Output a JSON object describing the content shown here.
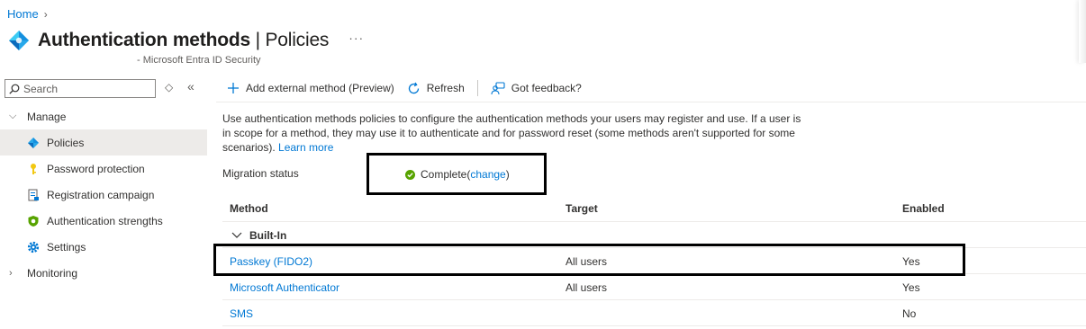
{
  "breadcrumb": {
    "home": "Home"
  },
  "header": {
    "title_main": "Authentication methods",
    "title_sep": " | ",
    "title_section": "Policies",
    "more": "···",
    "subtitle": "- Microsoft Entra ID Security"
  },
  "sidebar": {
    "search_placeholder": "Search",
    "groups": {
      "manage": "Manage",
      "monitoring": "Monitoring"
    },
    "items": [
      {
        "label": "Policies",
        "icon": "diamond-icon",
        "active": true
      },
      {
        "label": "Password protection",
        "icon": "key-icon"
      },
      {
        "label": "Registration campaign",
        "icon": "clipboard-icon"
      },
      {
        "label": "Authentication strengths",
        "icon": "shield-icon"
      },
      {
        "label": "Settings",
        "icon": "gear-icon"
      }
    ]
  },
  "toolbar": {
    "add_external": "Add external method (Preview)",
    "refresh": "Refresh",
    "feedback": "Got feedback?"
  },
  "description": {
    "text": "Use authentication methods policies to configure the authentication methods your users may register and use. If a user is in scope for a method, they may use it to authenticate and for password reset (some methods aren't supported for some scenarios).",
    "learn_more": "Learn more"
  },
  "migration": {
    "label": "Migration status",
    "status": "Complete",
    "open_paren": " (",
    "change": "change",
    "close_paren": ")",
    "status_color": "#57a300"
  },
  "table": {
    "headers": {
      "method": "Method",
      "target": "Target",
      "enabled": "Enabled"
    },
    "group": "Built-In",
    "rows": [
      {
        "method": "Passkey (FIDO2)",
        "target": "All users",
        "enabled": "Yes"
      },
      {
        "method": "Microsoft Authenticator",
        "target": "All users",
        "enabled": "Yes"
      },
      {
        "method": "SMS",
        "target": "",
        "enabled": "No"
      }
    ]
  },
  "colors": {
    "accent": "#0078d4",
    "active_bg": "#edebe9",
    "highlight_box": "#000000"
  }
}
